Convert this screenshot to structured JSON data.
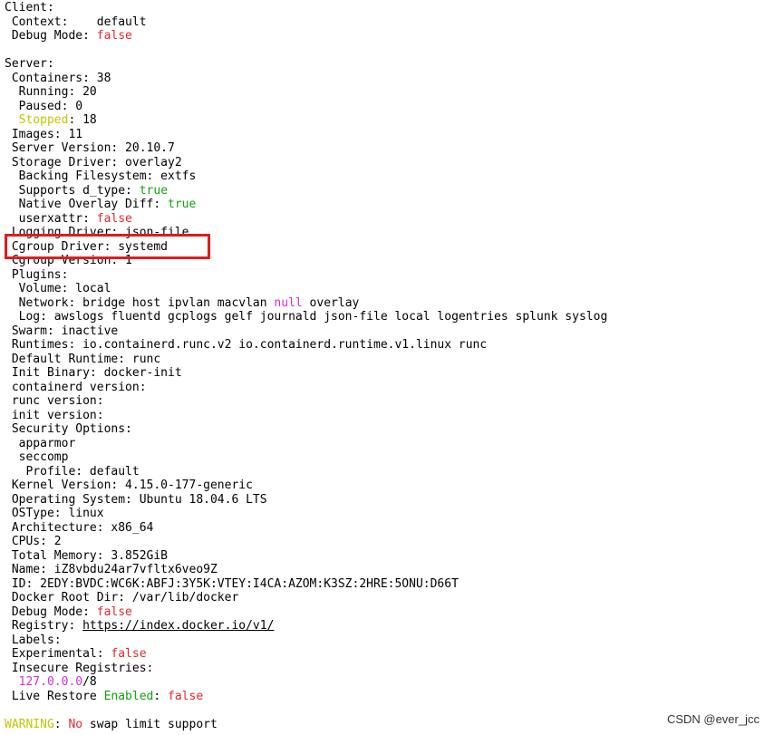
{
  "terminal": {
    "lines": [
      [
        {
          "t": "Client:"
        }
      ],
      [
        {
          "t": " Context:    default"
        }
      ],
      [
        {
          "t": " Debug Mode: "
        },
        {
          "t": "false",
          "c": "red"
        }
      ],
      [
        {
          "t": ""
        }
      ],
      [
        {
          "t": "Server:"
        }
      ],
      [
        {
          "t": " Containers: 38"
        }
      ],
      [
        {
          "t": "  Running: 20"
        }
      ],
      [
        {
          "t": "  Paused: 0"
        }
      ],
      [
        {
          "t": "  "
        },
        {
          "t": "Stopped",
          "c": "yellow"
        },
        {
          "t": ": 18"
        }
      ],
      [
        {
          "t": " Images: 11"
        }
      ],
      [
        {
          "t": " Server Version: 20.10.7"
        }
      ],
      [
        {
          "t": " Storage Driver: overlay2"
        }
      ],
      [
        {
          "t": "  Backing Filesystem: extfs"
        }
      ],
      [
        {
          "t": "  Supports d_type: "
        },
        {
          "t": "true",
          "c": "green"
        }
      ],
      [
        {
          "t": "  Native Overlay Diff: "
        },
        {
          "t": "true",
          "c": "green"
        }
      ],
      [
        {
          "t": "  userxattr: "
        },
        {
          "t": "false",
          "c": "red"
        }
      ],
      [
        {
          "t": " Logging Driver: json-file"
        }
      ],
      [
        {
          "t": " Cgroup Driver: systemd"
        }
      ],
      [
        {
          "t": " Cgroup Version: 1"
        }
      ],
      [
        {
          "t": " Plugins:"
        }
      ],
      [
        {
          "t": "  Volume: local"
        }
      ],
      [
        {
          "t": "  Network: bridge host ipvlan macvlan "
        },
        {
          "t": "null",
          "c": "magenta"
        },
        {
          "t": " overlay"
        }
      ],
      [
        {
          "t": "  Log: awslogs fluentd gcplogs gelf journald json-file local logentries splunk syslog"
        }
      ],
      [
        {
          "t": " Swarm: inactive"
        }
      ],
      [
        {
          "t": " Runtimes: io.containerd.runc.v2 io.containerd.runtime.v1.linux runc"
        }
      ],
      [
        {
          "t": " Default Runtime: runc"
        }
      ],
      [
        {
          "t": " Init Binary: docker-init"
        }
      ],
      [
        {
          "t": " containerd version:"
        }
      ],
      [
        {
          "t": " runc version:"
        }
      ],
      [
        {
          "t": " init version:"
        }
      ],
      [
        {
          "t": " Security Options:"
        }
      ],
      [
        {
          "t": "  apparmor"
        }
      ],
      [
        {
          "t": "  seccomp"
        }
      ],
      [
        {
          "t": "   Profile: default"
        }
      ],
      [
        {
          "t": " Kernel Version: 4.15.0-177-generic"
        }
      ],
      [
        {
          "t": " Operating System: Ubuntu 18.04.6 LTS"
        }
      ],
      [
        {
          "t": " OSType: linux"
        }
      ],
      [
        {
          "t": " Architecture: x86_64"
        }
      ],
      [
        {
          "t": " CPUs: 2"
        }
      ],
      [
        {
          "t": " Total Memory: 3.852GiB"
        }
      ],
      [
        {
          "t": " Name: iZ8vbdu24ar7vfltx6veo9Z"
        }
      ],
      [
        {
          "t": " ID: 2EDY:BVDC:WC6K:ABFJ:3Y5K:VTEY:I4CA:AZOM:K3SZ:2HRE:5ONU:D66T"
        }
      ],
      [
        {
          "t": " Docker Root Dir: /var/lib/docker"
        }
      ],
      [
        {
          "t": " Debug Mode: "
        },
        {
          "t": "false",
          "c": "red"
        }
      ],
      [
        {
          "t": " Registry: "
        },
        {
          "t": "https://index.docker.io/v1/",
          "c": "link"
        }
      ],
      [
        {
          "t": " Labels:"
        }
      ],
      [
        {
          "t": " Experimental: "
        },
        {
          "t": "false",
          "c": "red"
        }
      ],
      [
        {
          "t": " Insecure Registries:"
        }
      ],
      [
        {
          "t": "  "
        },
        {
          "t": "127.0.0.0",
          "c": "magenta"
        },
        {
          "t": "/8"
        }
      ],
      [
        {
          "t": " Live Restore "
        },
        {
          "t": "Enabled",
          "c": "green"
        },
        {
          "t": ": "
        },
        {
          "t": "false",
          "c": "red"
        }
      ],
      [
        {
          "t": ""
        }
      ],
      [
        {
          "t": "WARNING",
          "c": "yellow"
        },
        {
          "t": ": "
        },
        {
          "t": "No",
          "c": "red"
        },
        {
          "t": " swap limit support"
        }
      ]
    ],
    "highlight_line": " Cgroup Driver: systemd"
  },
  "watermark": "CSDN @ever_jcc",
  "colors": {
    "red": "#e02a2a",
    "green": "#13a10e",
    "yellow": "#c4c400",
    "magenta": "#d22fd2",
    "highlight_box": "#e01d1d"
  }
}
